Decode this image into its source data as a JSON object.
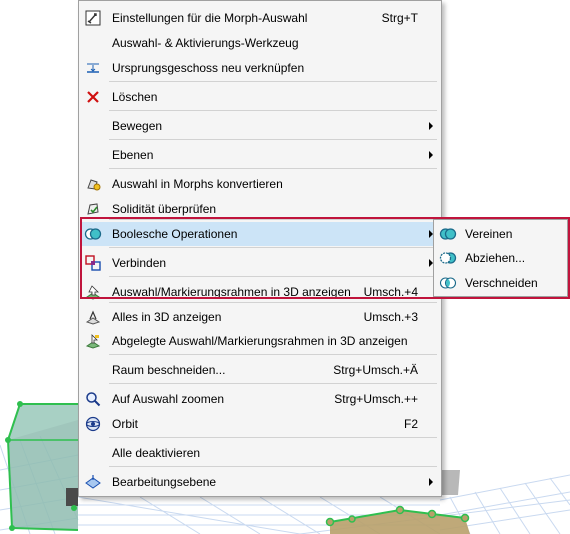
{
  "menu": {
    "items": [
      {
        "label": "Einstellungen für die Morph-Auswahl",
        "shortcut": "Strg+T",
        "icon": "morph-settings-icon"
      },
      {
        "label": "Auswahl- & Aktivierungs-Werkzeug",
        "shortcut": "",
        "icon": ""
      },
      {
        "label": "Ursprungsgeschoss neu verknüpfen",
        "shortcut": "",
        "icon": "relink-story-icon"
      },
      {
        "label": "Löschen",
        "shortcut": "",
        "icon": "delete-icon"
      },
      {
        "label": "Bewegen",
        "shortcut": "",
        "icon": ""
      },
      {
        "label": "Ebenen",
        "shortcut": "",
        "icon": ""
      },
      {
        "label": "Auswahl in Morphs konvertieren",
        "shortcut": "",
        "icon": "convert-morph-icon"
      },
      {
        "label": "Solidität überprüfen",
        "shortcut": "",
        "icon": "check-solidity-icon"
      },
      {
        "label": "Boolesche Operationen",
        "shortcut": "",
        "icon": "boolean-operations-icon"
      },
      {
        "label": "Verbinden",
        "shortcut": "",
        "icon": "connect-icon"
      },
      {
        "label": "Auswahl/Markierungsrahmen in 3D anzeigen",
        "shortcut": "Umsch.+4",
        "icon": "show-3d-selection-icon"
      },
      {
        "label": "Alles in 3D anzeigen",
        "shortcut": "Umsch.+3",
        "icon": "show-all-3d-icon"
      },
      {
        "label": "Abgelegte Auswahl/Markierungsrahmen in 3D anzeigen",
        "shortcut": "",
        "icon": "stored-selection-3d-icon"
      },
      {
        "label": "Raum beschneiden...",
        "shortcut": "Strg+Umsch.+Ä",
        "icon": ""
      },
      {
        "label": "Auf Auswahl zoomen",
        "shortcut": "Strg+Umsch.++",
        "icon": "zoom-selection-icon"
      },
      {
        "label": "Orbit",
        "shortcut": "F2",
        "icon": "orbit-icon"
      },
      {
        "label": "Alle deaktivieren",
        "shortcut": "",
        "icon": ""
      },
      {
        "label": "Bearbeitungsebene",
        "shortcut": "",
        "icon": "editing-plane-icon"
      }
    ]
  },
  "submenu": {
    "items": [
      {
        "label": "Vereinen",
        "icon": "union-icon"
      },
      {
        "label": "Abziehen...",
        "icon": "subtract-icon"
      },
      {
        "label": "Verschneiden",
        "icon": "intersect-icon"
      }
    ]
  },
  "colors": {
    "highlight": "#cce4f7",
    "frame": "#c0143c",
    "menu_bg": "#f5f5f5",
    "morph_green": "#2fbf4f",
    "morph_fill": "#7fb3a8"
  }
}
